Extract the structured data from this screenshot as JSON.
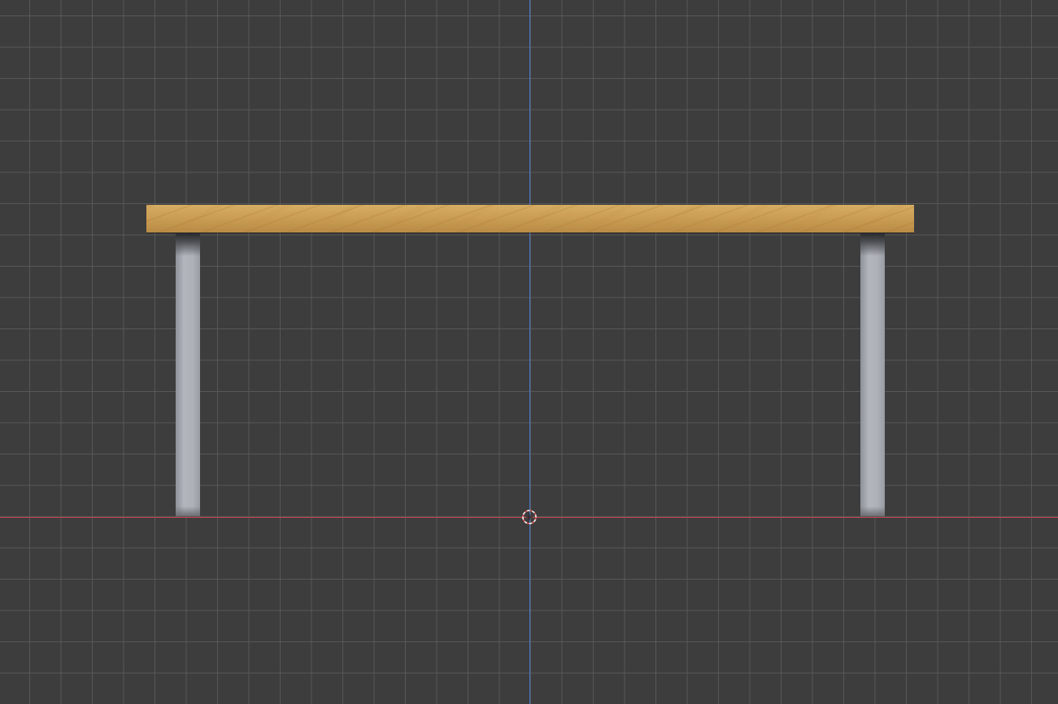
{
  "viewport": {
    "background_color": "#3d3d3d",
    "grid_color": "#5a5a5a",
    "axis_x_color": "#c5434e",
    "axis_z_color": "#4a78c8"
  },
  "scene": {
    "objects": [
      {
        "name": "tabletop",
        "material": "wood",
        "color": "#c89b52"
      },
      {
        "name": "leg-left",
        "material": "metal",
        "color": "#b3b6bd"
      },
      {
        "name": "leg-right",
        "material": "metal",
        "color": "#b3b6bd"
      }
    ],
    "cursor": {
      "icon": "3d-cursor-icon",
      "colors": [
        "#d24b4b",
        "#ffffff"
      ]
    }
  }
}
